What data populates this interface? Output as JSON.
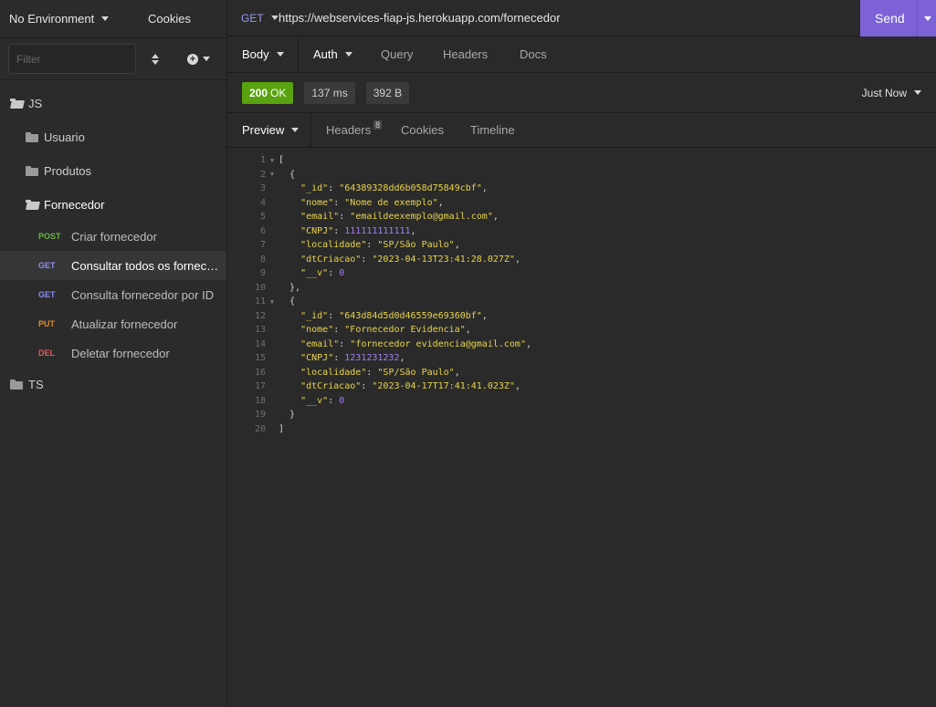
{
  "sidebar": {
    "environment": "No Environment",
    "cookies": "Cookies",
    "filter_placeholder": "Filter",
    "folders": {
      "js": "JS",
      "usuario": "Usuario",
      "produtos": "Produtos",
      "fornecedor": "Fornecedor",
      "ts": "TS"
    },
    "requests": [
      {
        "method": "POST",
        "name": "Criar fornecedor"
      },
      {
        "method": "GET",
        "name": "Consultar todos os fornecedores"
      },
      {
        "method": "GET",
        "name": "Consulta fornecedor por ID"
      },
      {
        "method": "PUT",
        "name": "Atualizar fornecedor"
      },
      {
        "method": "DEL",
        "name": "Deletar fornecedor"
      }
    ]
  },
  "request": {
    "method": "GET",
    "url": "https://webservices-fiap-js.herokuapp.com/fornecedor",
    "send": "Send",
    "tabs": {
      "body": "Body",
      "auth": "Auth",
      "query": "Query",
      "headers": "Headers",
      "docs": "Docs"
    }
  },
  "response": {
    "status_code": "200",
    "status_text": "OK",
    "time": "137 ms",
    "size": "392 B",
    "timestamp": "Just Now",
    "tabs": {
      "preview": "Preview",
      "headers": "Headers",
      "headers_count": "8",
      "cookies": "Cookies",
      "timeline": "Timeline"
    },
    "items": [
      {
        "_id": "64389328dd6b058d75849cbf",
        "nome": "Nome de exemplo",
        "email": "emaildeexemplo@gmail.com",
        "CNPJ": "111111111111",
        "localidade": "SP/São Paulo",
        "dtCriacao": "2023-04-13T23:41:28.027Z",
        "__v": "0"
      },
      {
        "_id": "643d84d5d0d46559e69360bf",
        "nome": "Fornecedor Evidencia",
        "email": "fornecedor evidencia@gmail.com",
        "CNPJ": "1231231232",
        "localidade": "SP/São Paulo",
        "dtCriacao": "2023-04-17T17:41:41.023Z",
        "__v": "0"
      }
    ]
  },
  "colors": {
    "send": "#7c62d6",
    "status_ok": "#59a210",
    "get": "#8d8df0",
    "post": "#65b542",
    "put": "#e08d2b",
    "del": "#e25a5a"
  }
}
